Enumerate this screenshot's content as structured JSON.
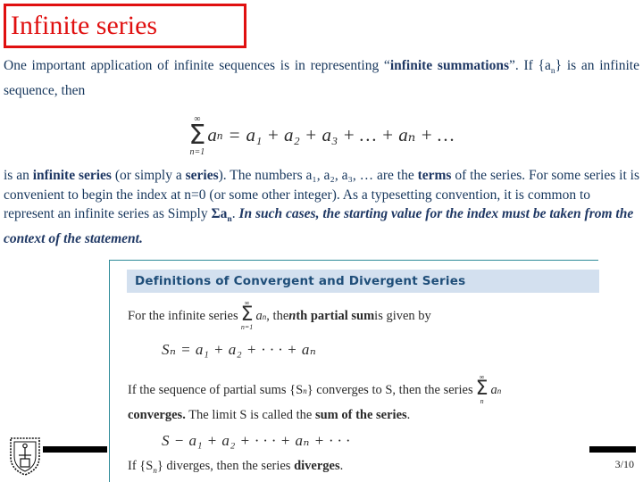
{
  "slide": {
    "title": "Infinite series",
    "title_color": "#e01010",
    "text_color": "#16365c",
    "accent_blue": "#1f3864",
    "banner_color": "#d3e0ef",
    "border_color": "#2e8b98",
    "page_number": "3/10"
  },
  "intro": {
    "part1": "One important application of infinite sequences is in representing “",
    "emphasis": "infinite summations",
    "part2": "”. If {a",
    "sub_n": "n",
    "part3": "} is an infinite sequence, then"
  },
  "main_formula": {
    "sigma": "Σ",
    "limit_top": "∞",
    "limit_bottom": "n=1",
    "term": "a",
    "term_sub": "n",
    "equals": "=",
    "rhs": "a₁ + a₂ + a₃ + … + aₙ + …"
  },
  "body": {
    "l1a": "is an ",
    "l1b": "infinite series",
    "l1c": " (or simply a ",
    "l1d": "series",
    "l1e": "). The numbers a₁, a₂, a₃, … are the ",
    "l1f": "terms",
    "l1g": " of the series. For some series it is convenient to begin the index at n=0 (or some other integer). As a typesetting convention, it is common to represent an infinite series as Simply ",
    "l1h": "Σa",
    "l1h_sub": "n",
    "l1i": ".",
    "emphasis_line": "In such cases, the starting value for the index must be taken from the context of the statement",
    "emphasis_end": "."
  },
  "definitions": {
    "banner": "Definitions of Convergent and Divergent Series",
    "line1_a": "For the infinite series",
    "line1_sigma": "Σ",
    "line1_top": "∞",
    "line1_bottom": "n=1",
    "line1_term": "a",
    "line1_term_sub": "n",
    "line1_b": ", the ",
    "line1_c": "n",
    "line1_d": "th partial sum",
    "line1_e": " is given by",
    "equation1": "Sₙ = a₁ + a₂ + · · · + aₙ",
    "line2_a": "If the sequence of partial sums {S",
    "line2_sub": "n",
    "line2_b": "} converges to S, then the series",
    "line2_sigma": "Σ",
    "line2_top": "∞",
    "line2_bottom": "n",
    "line2_term": "a",
    "line2_term_sub": "n",
    "line3_a": "converges.",
    "line3_b": " The limit S is called the ",
    "line3_c": "sum of the series",
    "line3_d": ".",
    "equation2": "S − a₁ + a₂ + · · · + aₙ + · · ·",
    "line4_a": "If {S",
    "line4_sub": "n",
    "line4_b": "} diverges, then the series ",
    "line4_c": "diverges",
    "line4_d": "."
  }
}
